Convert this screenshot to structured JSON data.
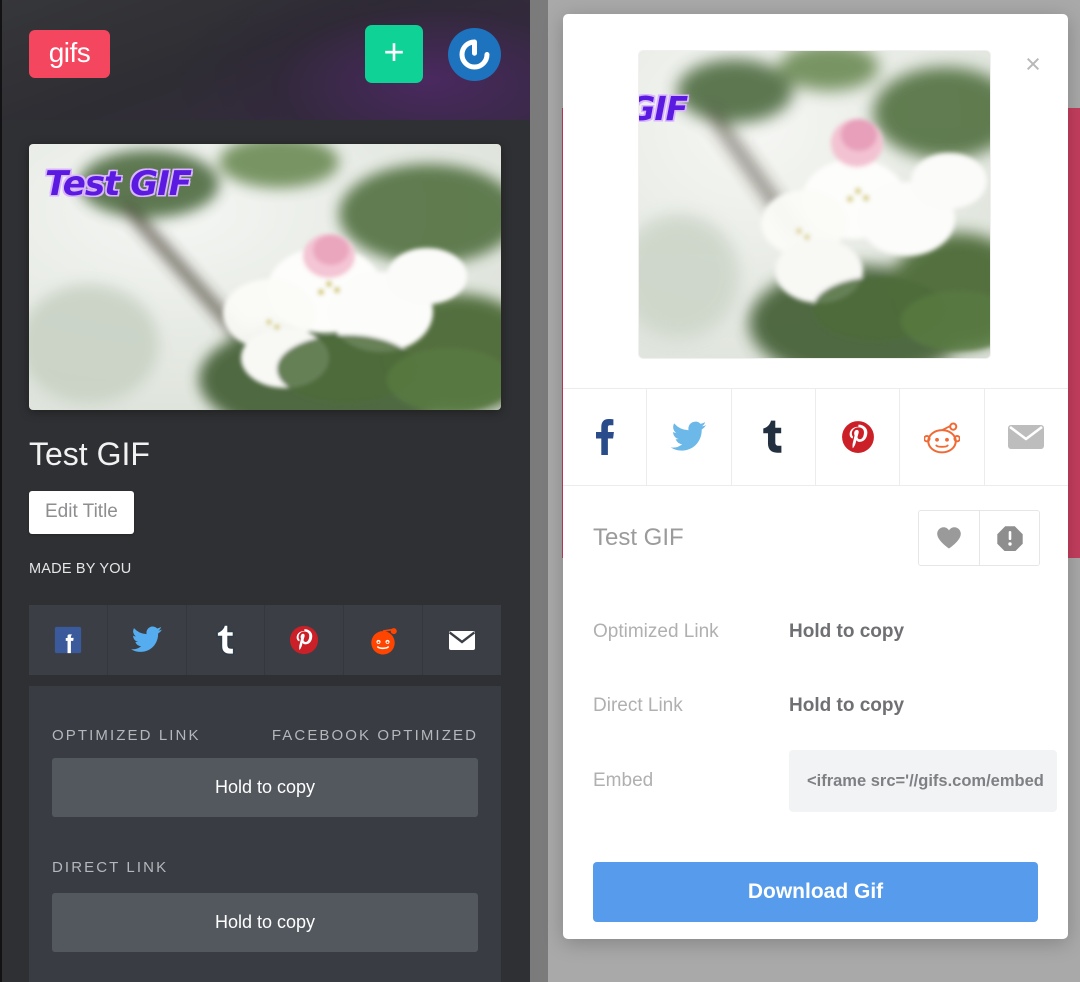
{
  "app": {
    "logo_text": "gifs",
    "add_button_label": "+",
    "account_icon": "gravatar-icon"
  },
  "left_panel": {
    "gif_overlay_text": "Test GIF",
    "title": "Test GIF",
    "edit_title_label": "Edit Title",
    "made_by_label": "MADE BY YOU",
    "share": [
      {
        "name": "facebook",
        "icon": "facebook-icon"
      },
      {
        "name": "twitter",
        "icon": "twitter-icon"
      },
      {
        "name": "tumblr",
        "icon": "tumblr-icon"
      },
      {
        "name": "pinterest",
        "icon": "pinterest-icon"
      },
      {
        "name": "reddit",
        "icon": "reddit-icon"
      },
      {
        "name": "email",
        "icon": "mail-icon"
      }
    ],
    "optimized_link_label": "OPTIMIZED LINK",
    "facebook_optimized_label": "FACEBOOK OPTIMIZED",
    "optimized_hold_label": "Hold to copy",
    "direct_link_label": "DIRECT LINK",
    "direct_hold_label": "Hold to copy"
  },
  "modal": {
    "close_label": "×",
    "gif_overlay_text": "t GIF",
    "share": [
      {
        "name": "facebook",
        "icon": "facebook-icon"
      },
      {
        "name": "twitter",
        "icon": "twitter-icon"
      },
      {
        "name": "tumblr",
        "icon": "tumblr-icon"
      },
      {
        "name": "pinterest",
        "icon": "pinterest-icon"
      },
      {
        "name": "reddit",
        "icon": "reddit-icon"
      },
      {
        "name": "email",
        "icon": "mail-icon"
      }
    ],
    "title": "Test GIF",
    "favorite_icon": "heart-icon",
    "report_icon": "report-icon",
    "optimized_link_label": "Optimized Link",
    "optimized_link_value": "Hold to copy",
    "direct_link_label": "Direct Link",
    "direct_link_value": "Hold to copy",
    "embed_label": "Embed",
    "embed_value": "<iframe src='//gifs.com/embed",
    "download_label": "Download Gif"
  },
  "colors": {
    "brand_pink": "#f5465f",
    "add_green": "#0fd296",
    "gravatar_blue": "#1e73be",
    "download_blue": "#569bec",
    "crimson": "#c43e5e",
    "panel_dark": "#2f3033",
    "overlay_purple": "#5b1ae0"
  }
}
